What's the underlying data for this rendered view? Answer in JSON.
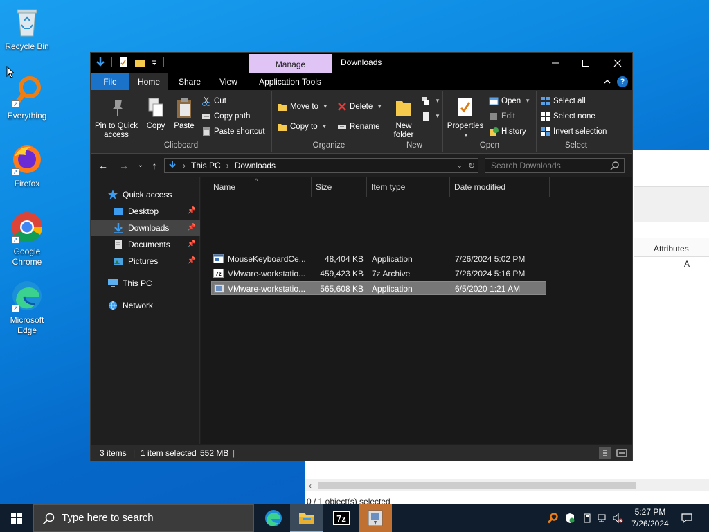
{
  "desktop": {
    "icons": [
      {
        "label": "Recycle Bin"
      },
      {
        "label": "Everything"
      },
      {
        "label": "Firefox"
      },
      {
        "label": "Google Chrome"
      },
      {
        "label": "Microsoft Edge"
      }
    ]
  },
  "background_window": {
    "column_header": "Attributes",
    "attribute_value": "A",
    "status": "0 / 1 object(s) selected"
  },
  "explorer": {
    "title": "Downloads",
    "context_tab": "Manage",
    "tabs": {
      "file": "File",
      "home": "Home",
      "share": "Share",
      "view": "View",
      "app_tools": "Application Tools"
    },
    "ribbon": {
      "clipboard": {
        "label": "Clipboard",
        "pin": "Pin to Quick access",
        "copy": "Copy",
        "paste": "Paste",
        "cut": "Cut",
        "copy_path": "Copy path",
        "paste_shortcut": "Paste shortcut"
      },
      "organize": {
        "label": "Organize",
        "move_to": "Move to",
        "copy_to": "Copy to",
        "delete": "Delete",
        "rename": "Rename"
      },
      "new": {
        "label": "New",
        "new_folder": "New folder"
      },
      "open": {
        "label": "Open",
        "properties": "Properties",
        "open": "Open",
        "edit": "Edit",
        "history": "History"
      },
      "select": {
        "label": "Select",
        "select_all": "Select all",
        "select_none": "Select none",
        "invert": "Invert selection"
      }
    },
    "address": {
      "crumbs": [
        "This PC",
        "Downloads"
      ],
      "search_placeholder": "Search Downloads"
    },
    "nav": {
      "quick_access": "Quick access",
      "desktop": "Desktop",
      "downloads": "Downloads",
      "documents": "Documents",
      "pictures": "Pictures",
      "this_pc": "This PC",
      "network": "Network"
    },
    "columns": {
      "name": "Name",
      "size": "Size",
      "type": "Item type",
      "date": "Date modified"
    },
    "files": [
      {
        "name": "MouseKeyboardCe...",
        "size": "48,404 KB",
        "type": "Application",
        "date": "7/26/2024 5:02 PM"
      },
      {
        "name": "VMware-workstatio...",
        "size": "459,423 KB",
        "type": "7z Archive",
        "date": "7/26/2024 5:16 PM"
      },
      {
        "name": "VMware-workstatio...",
        "size": "565,608 KB",
        "type": "Application",
        "date": "6/5/2020 1:21 AM"
      }
    ],
    "status": {
      "count": "3 items",
      "selected": "1 item selected",
      "size": "552 MB"
    }
  },
  "taskbar": {
    "search_placeholder": "Type here to search",
    "time": "5:27 PM",
    "date": "7/26/2024"
  }
}
